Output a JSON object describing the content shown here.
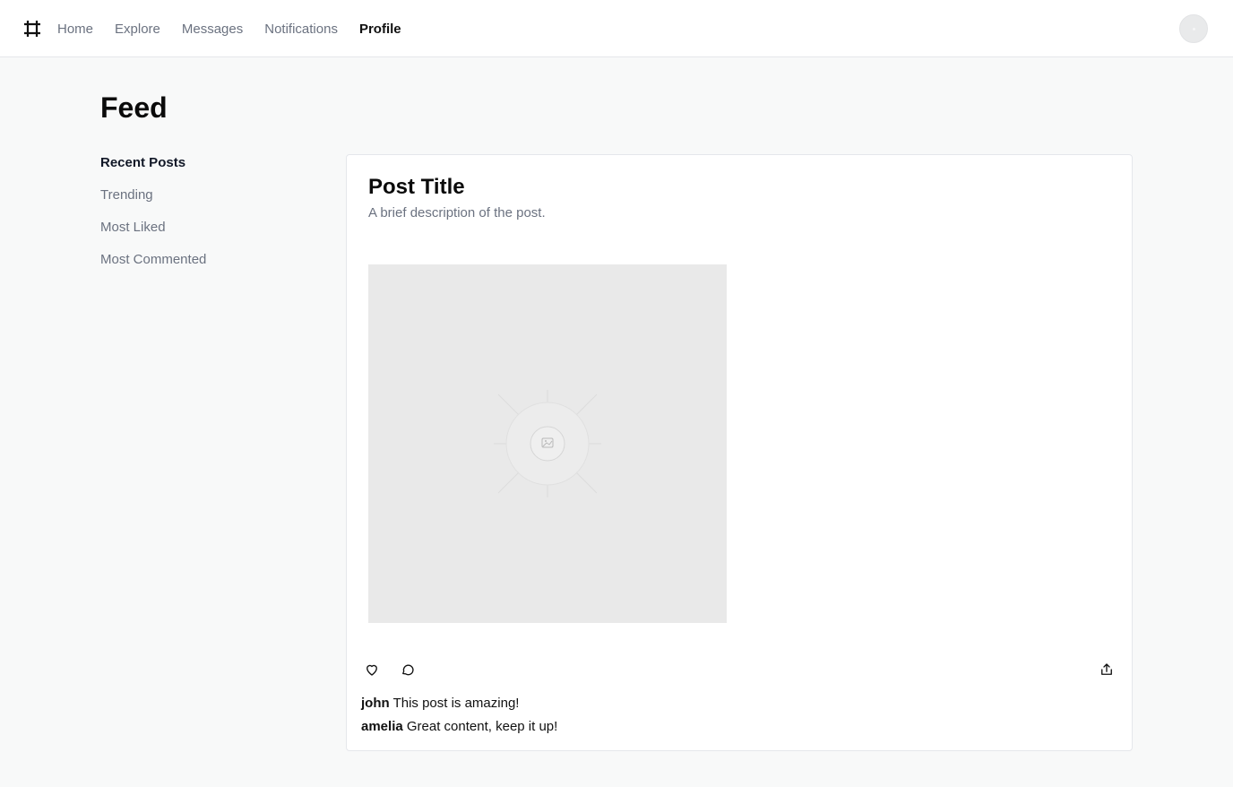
{
  "nav": {
    "logo_icon": "hash-icon",
    "items": [
      {
        "label": "Home",
        "active": false
      },
      {
        "label": "Explore",
        "active": false
      },
      {
        "label": "Messages",
        "active": false
      },
      {
        "label": "Notifications",
        "active": false
      },
      {
        "label": "Profile",
        "active": true
      }
    ],
    "avatar_icon": "avatar-icon"
  },
  "page": {
    "title": "Feed"
  },
  "sidebar": {
    "items": [
      {
        "label": "Recent Posts",
        "active": true
      },
      {
        "label": "Trending",
        "active": false
      },
      {
        "label": "Most Liked",
        "active": false
      },
      {
        "label": "Most Commented",
        "active": false
      }
    ]
  },
  "post": {
    "title": "Post Title",
    "description": "A brief description of the post.",
    "image_icon": "image-icon",
    "actions": {
      "like_icon": "heart-icon",
      "comment_icon": "comment-icon",
      "share_icon": "share-icon"
    },
    "comments": [
      {
        "user": "john",
        "text": "This post is amazing!"
      },
      {
        "user": "amelia",
        "text": "Great content, keep it up!"
      }
    ]
  },
  "colors": {
    "background": "#f8f9f9",
    "surface": "#ffffff",
    "border": "#e5e7eb",
    "muted_text": "#6b7280",
    "text": "#111111",
    "image_placeholder": "#e9e9e9"
  }
}
